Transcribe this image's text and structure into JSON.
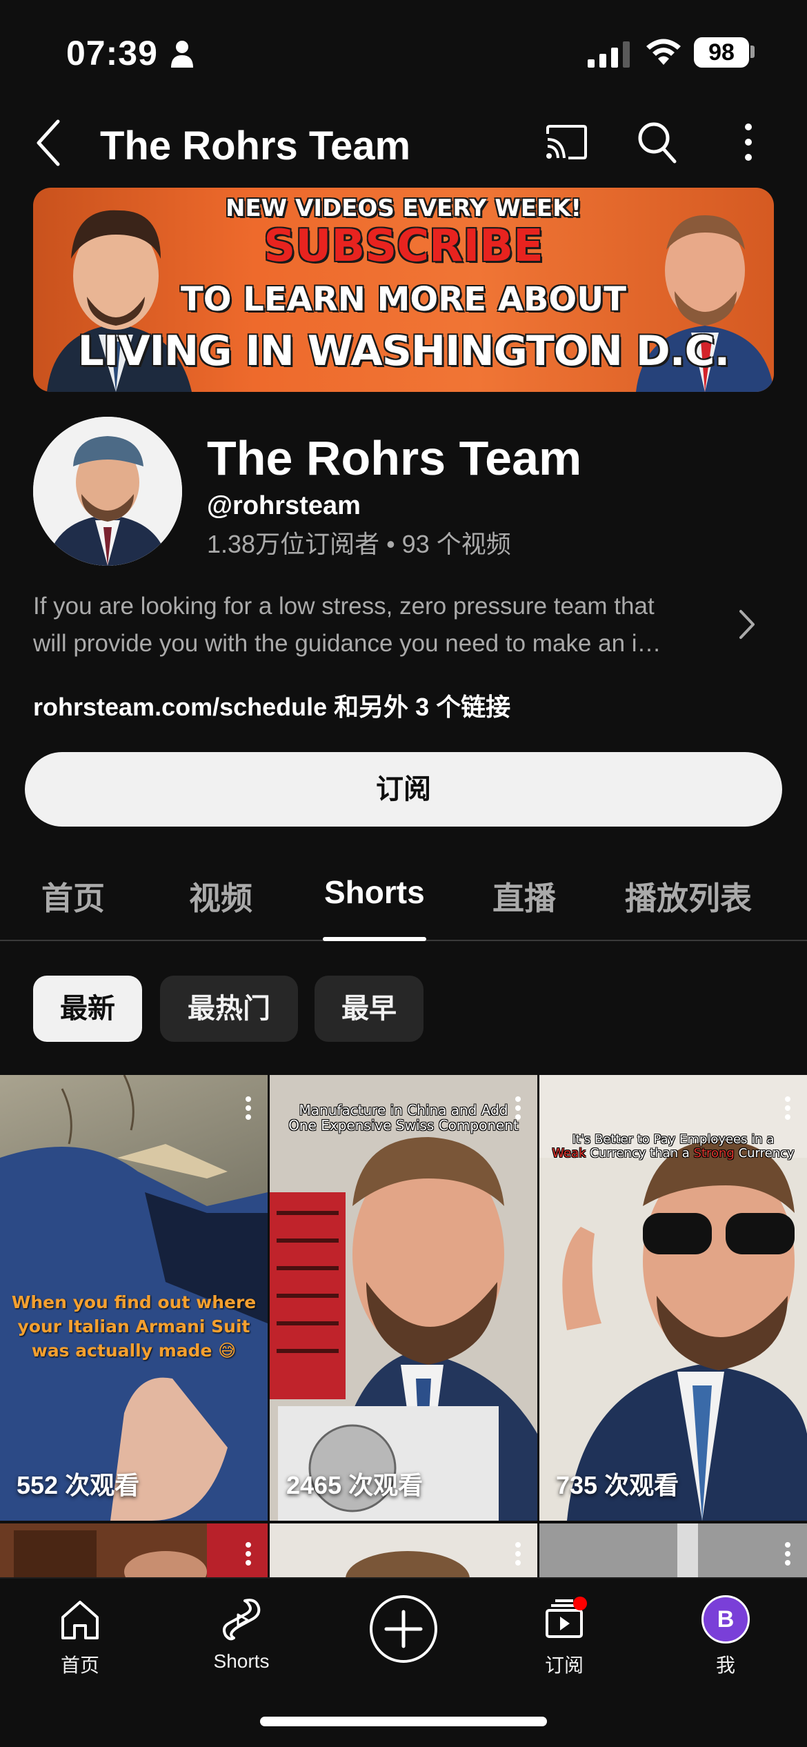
{
  "status_bar": {
    "time": "07:39",
    "battery": "98"
  },
  "header": {
    "title": "The Rohrs Team"
  },
  "banner": {
    "line1": "NEW VIDEOS EVERY WEEK!",
    "line2": "SUBSCRIBE",
    "line3": "TO LEARN MORE ABOUT",
    "line4": "LIVING IN WASHINGTON D.C."
  },
  "channel": {
    "name": "The Rohrs Team",
    "handle": "@rohrsteam",
    "stats": "1.38万位订阅者 • 93 个视频",
    "description_line1": "If you are looking for a low stress, zero pressure team that",
    "description_line2": "will provide you with the guidance you need to make an i…",
    "links": "rohrsteam.com/schedule 和另外 3 个链接",
    "subscribe_label": "订阅",
    "avatar_initial": "B"
  },
  "tabs": [
    {
      "label": "首页"
    },
    {
      "label": "视频"
    },
    {
      "label": "Shorts"
    },
    {
      "label": "直播"
    },
    {
      "label": "播放列表"
    }
  ],
  "active_tab": "Shorts",
  "chips": [
    {
      "label": "最新",
      "selected": true
    },
    {
      "label": "最热门",
      "selected": false
    },
    {
      "label": "最早",
      "selected": false
    }
  ],
  "shorts": [
    {
      "views": "552 次观看",
      "caption": "When you find out where your Italian Armani Suit was actually made 😅"
    },
    {
      "views": "2465 次观看",
      "caption_line1": "Manufacture in China and Add",
      "caption_line2": "One Expensive Swiss Component"
    },
    {
      "views": "735 次观看",
      "caption_line1": "It's Better to Pay Employees in a",
      "caption_line2_a": "Weak",
      "caption_line2_b": " Currency than a ",
      "caption_line2_c": "Strong",
      "caption_line2_d": " Currency"
    }
  ],
  "bottom_nav": {
    "home": "首页",
    "shorts": "Shorts",
    "subscriptions": "订阅",
    "me": "我"
  },
  "colors": {
    "background": "#0f0f0f",
    "accent_red": "#ff0000",
    "avatar_purple": "#7a3fd8"
  }
}
